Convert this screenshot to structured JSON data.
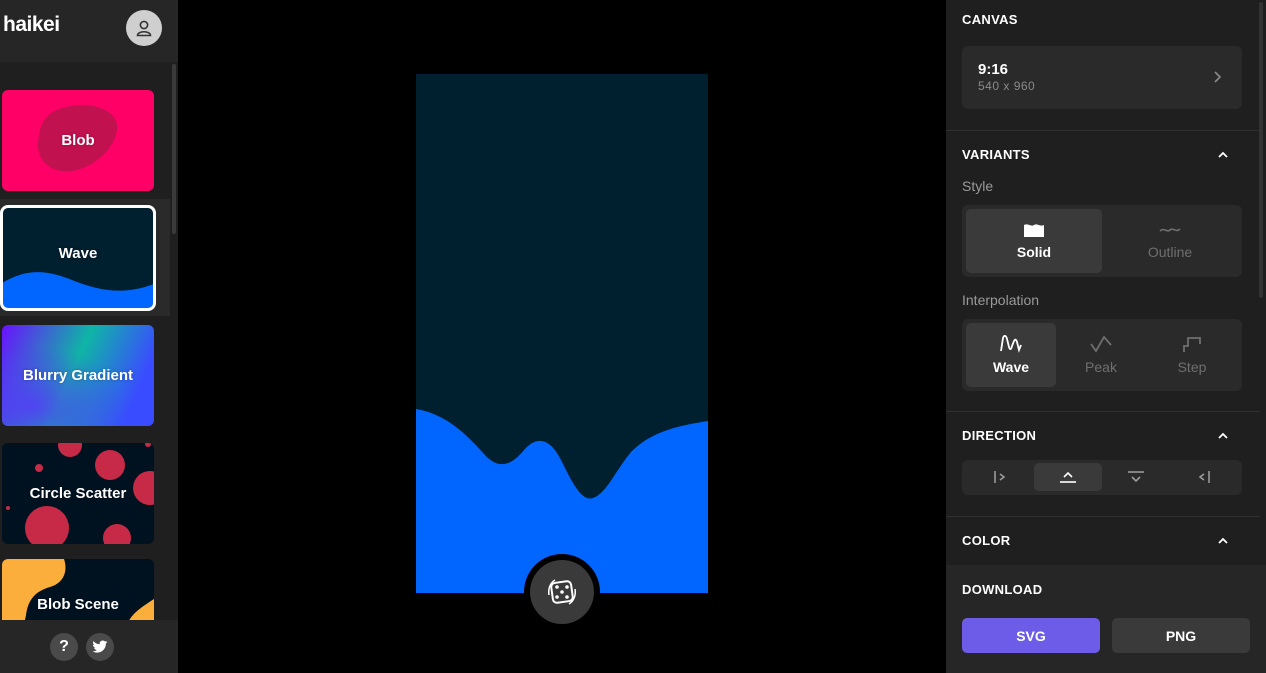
{
  "app": {
    "logo_text": "haikei"
  },
  "sidebar": {
    "generators": [
      {
        "label": "Blob",
        "color": "#ff0066"
      },
      {
        "label": "Wave",
        "color": "#001f2f",
        "accent": "#0066ff",
        "selected": true
      },
      {
        "label": "Blurry Gradient",
        "color": "#5b2cf5"
      },
      {
        "label": "Circle Scatter",
        "color": "#001220",
        "accent": "#c62a47"
      },
      {
        "label": "Blob Scene",
        "color": "#001220",
        "accent": "#fbae3c"
      }
    ],
    "footer": {
      "help_label": "?"
    }
  },
  "canvas": {
    "background_color": "#001f2f",
    "wave_color": "#0066ff"
  },
  "panel": {
    "canvas_section": {
      "title": "CANVAS",
      "ratio": "9:16",
      "size": "540 x 960"
    },
    "variants": {
      "title": "VARIANTS",
      "style_label": "Style",
      "style_options": [
        {
          "label": "Solid",
          "icon": "solid-wave-icon",
          "selected": true
        },
        {
          "label": "Outline",
          "icon": "outline-wave-icon",
          "selected": false
        }
      ],
      "interpolation_label": "Interpolation",
      "interpolation_options": [
        {
          "label": "Wave",
          "icon": "wave-icon",
          "selected": true
        },
        {
          "label": "Peak",
          "icon": "peak-icon",
          "selected": false
        },
        {
          "label": "Step",
          "icon": "step-icon",
          "selected": false
        }
      ]
    },
    "direction": {
      "title": "DIRECTION",
      "options": [
        {
          "icon": "direction-left-icon",
          "selected": false
        },
        {
          "icon": "direction-up-icon",
          "selected": true
        },
        {
          "icon": "direction-down-icon",
          "selected": false
        },
        {
          "icon": "direction-right-icon",
          "selected": false
        }
      ]
    },
    "color": {
      "title": "COLOR"
    },
    "download": {
      "title": "DOWNLOAD",
      "svg_label": "SVG",
      "png_label": "PNG",
      "svg_color": "#6c5ce7",
      "png_color": "#3a3a3a"
    }
  }
}
